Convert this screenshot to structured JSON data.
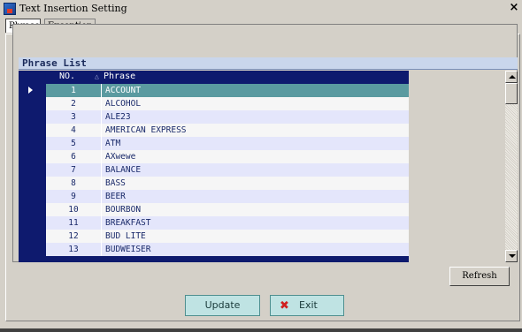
{
  "window": {
    "title": "Text Insertion Setting",
    "close_glyph": "×"
  },
  "tabs": [
    {
      "label": "Phrase",
      "active": true
    },
    {
      "label": "Exception",
      "active": false
    }
  ],
  "grid": {
    "caption": "Phrase List",
    "columns": {
      "no": "NO.",
      "phrase": "Phrase",
      "sort_glyph": "△"
    },
    "selected_index": 0,
    "rows": [
      {
        "no": "1",
        "phrase": "ACCOUNT"
      },
      {
        "no": "2",
        "phrase": "ALCOHOL"
      },
      {
        "no": "3",
        "phrase": "ALE23"
      },
      {
        "no": "4",
        "phrase": "AMERICAN EXPRESS"
      },
      {
        "no": "5",
        "phrase": "ATM"
      },
      {
        "no": "6",
        "phrase": "AXwewe"
      },
      {
        "no": "7",
        "phrase": "BALANCE"
      },
      {
        "no": "8",
        "phrase": "BASS"
      },
      {
        "no": "9",
        "phrase": "BEER"
      },
      {
        "no": "10",
        "phrase": "BOURBON"
      },
      {
        "no": "11",
        "phrase": "BREAKFAST"
      },
      {
        "no": "12",
        "phrase": "BUD LITE"
      },
      {
        "no": "13",
        "phrase": "BUDWEISER"
      }
    ]
  },
  "buttons": {
    "refresh": "Refresh",
    "update": "Update",
    "exit": "Exit",
    "exit_icon": "✖"
  },
  "colors": {
    "grid_header": "#0e1a6e",
    "selected_row": "#5a9aa0",
    "action_button": "#bfe3e3"
  }
}
